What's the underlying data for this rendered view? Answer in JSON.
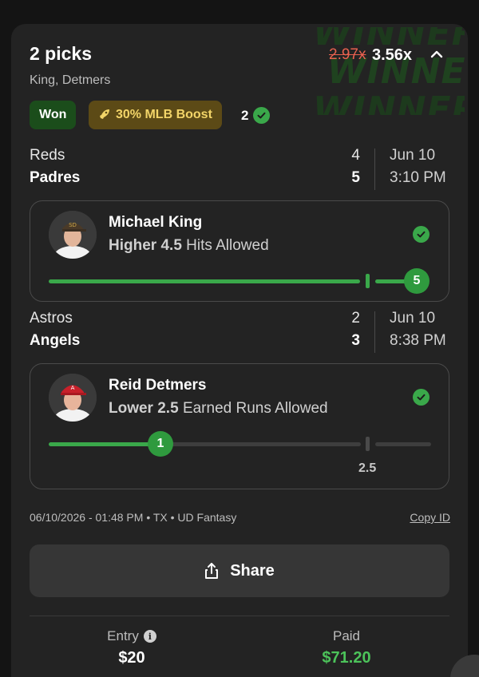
{
  "header": {
    "title": "2 picks",
    "subtitle": "King, Detmers",
    "multiplier_original": "2.97x",
    "multiplier_boosted": "3.56x",
    "watermark_text": "WINNER!!"
  },
  "badges": {
    "status": "Won",
    "boost": "30% MLB Boost",
    "correct_count": "2"
  },
  "picks": [
    {
      "game": {
        "team_away": "Reds",
        "score_away": "4",
        "team_home": "Padres",
        "score_home": "5",
        "date": "Jun 10",
        "time": "3:10 PM"
      },
      "player": "Michael King",
      "direction": "Higher",
      "line": "4.5",
      "stat": "Hits Allowed",
      "result_value": "5",
      "line_label": "",
      "won": true
    },
    {
      "game": {
        "team_away": "Astros",
        "score_away": "2",
        "team_home": "Angels",
        "score_home": "3",
        "date": "Jun 10",
        "time": "8:38 PM"
      },
      "player": "Reid Detmers",
      "direction": "Lower",
      "line": "2.5",
      "stat": "Earned Runs Allowed",
      "result_value": "1",
      "line_label": "2.5",
      "won": true
    }
  ],
  "footer": {
    "meta": "06/10/2026 - 01:48 PM • TX • UD Fantasy",
    "copy_id": "Copy ID",
    "share": "Share",
    "entry_label": "Entry",
    "entry_value": "$20",
    "paid_label": "Paid",
    "paid_value": "$71.20"
  },
  "colors": {
    "accent_green": "#3aa84a",
    "paid_green": "#4cc35a",
    "boost_text": "#f2d468",
    "strike_red": "#e8614f"
  },
  "icons": [
    "chevron-up-icon",
    "rocket-icon",
    "check-circle-icon",
    "share-icon",
    "info-icon"
  ]
}
